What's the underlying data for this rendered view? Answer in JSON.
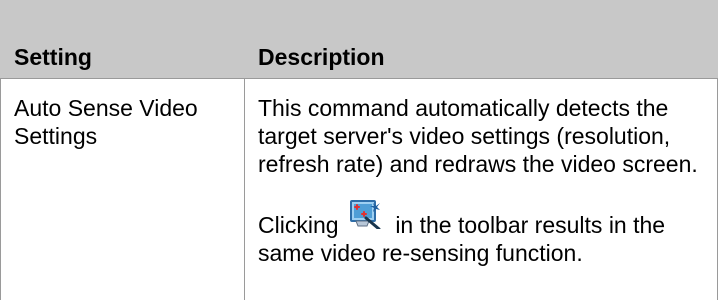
{
  "table": {
    "headers": {
      "setting": "Setting",
      "description": "Description"
    },
    "rows": [
      {
        "setting": "Auto Sense Video Settings",
        "description": {
          "paragraph_1": "This command automatically detects the target server's video settings (resolution, refresh rate) and redraws the video screen.",
          "paragraph_2_before_icon": "Clicking",
          "paragraph_2_icon": "auto-sense-video-icon",
          "paragraph_2_after_icon": "in the toolbar results in the same video re-sensing function."
        }
      }
    ]
  },
  "colors": {
    "header_background": "#c8c8c8",
    "border": "#9a9a9a",
    "icon_screen": "#4f9ed6",
    "icon_magic": "#1e5f9f",
    "icon_red": "#e03131"
  }
}
